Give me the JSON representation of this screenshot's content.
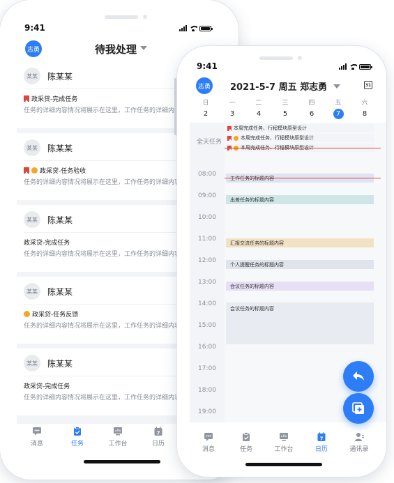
{
  "left_phone": {
    "status_time": "9:41",
    "header": {
      "avatar": "志勇",
      "title": "待我处理"
    },
    "cards": [
      {
        "avatar": "某某",
        "name": "陈某某",
        "flag": true,
        "dot": false,
        "task": "政采贷-完成任务",
        "desc": "任务的详细内容情况将展示在这里，工作任务的详细内容情况将展示在这里..."
      },
      {
        "avatar": "某某",
        "name": "陈某某",
        "flag": true,
        "dot": true,
        "task": "政采贷-任务验收",
        "desc": "任务的详细内容情况将展示在这里，工作任务的详细内容情况将展示在这里..."
      },
      {
        "avatar": "某某",
        "name": "陈某某",
        "flag": false,
        "dot": false,
        "task": "政采贷-完成任务",
        "desc": "任务的详细内容情况将展示在这里，工作任务的详细内容情况将展示在这里..."
      },
      {
        "avatar": "某某",
        "name": "陈某某",
        "flag": false,
        "dot": true,
        "task": "政采贷-任务反馈",
        "desc": "任务的详细内容情况将展示在这里，工作任务的详细内容情况将展示在这里..."
      },
      {
        "avatar": "某某",
        "name": "陈某某",
        "flag": false,
        "dot": false,
        "task": "政采贷-完成任务",
        "desc": "任务的详细内容情况将展示在这里，工作任务的详细内容情况将展示在这里..."
      }
    ],
    "tabs": [
      "消息",
      "任务",
      "工作台",
      "日历"
    ],
    "active_tab": "任务"
  },
  "right_phone": {
    "status_time": "9:41",
    "header": {
      "avatar": "志勇",
      "title": "2021-5-7  周五  郑志勇",
      "calendar_icon_day": "31"
    },
    "week": [
      {
        "day": "日",
        "date": "2"
      },
      {
        "day": "一",
        "date": "3"
      },
      {
        "day": "二",
        "date": "4"
      },
      {
        "day": "三",
        "date": "5"
      },
      {
        "day": "四",
        "date": "6"
      },
      {
        "day": "五",
        "date": "7"
      },
      {
        "day": "六",
        "date": "8"
      }
    ],
    "selected_date": "7",
    "allday_label": "全天任务",
    "allday_tasks": [
      {
        "text": "本周完成任务、行程模块原型设计",
        "flag": true,
        "dot": false,
        "struck": false
      },
      {
        "text": "本周完成任务、行程模块原型设计",
        "flag": true,
        "dot": true,
        "struck": false
      },
      {
        "text": "本周完成任务、行程模块原型设计",
        "flag": true,
        "dot": true,
        "struck": true
      }
    ],
    "hours": [
      "08:00",
      "09:00",
      "10:00",
      "11:00",
      "12:00",
      "13:00",
      "14:00",
      "15:00",
      "16:00",
      "17:00",
      "18:00",
      "19:00"
    ],
    "events": [
      {
        "text": "工作任务的标题内容",
        "color": "#dfe4f2",
        "struck": true
      },
      {
        "text": "出差任务的标题内容",
        "color": "#cfe6e8"
      },
      {
        "text": "汇报交流任务的标题内容",
        "color": "#f2e2c4"
      },
      {
        "text": "个人提醒任务的标题内容",
        "color": "#dfe3ec"
      },
      {
        "text": "会议任务的标题内容",
        "color": "#e6dff6"
      },
      {
        "text": "会议任务的标题内容",
        "color": "#e8ebf2"
      }
    ],
    "tabs": [
      "消息",
      "任务",
      "工作台",
      "日历",
      "通讯录"
    ],
    "active_tab": "日历"
  },
  "colors": {
    "accent": "#2c7df6",
    "flag": "#e0443c",
    "dot": "#f5a623"
  },
  "icons": [
    "message-icon",
    "task-icon",
    "workbench-icon",
    "calendar-icon",
    "contacts-icon",
    "reply-icon",
    "add-task-icon"
  ]
}
